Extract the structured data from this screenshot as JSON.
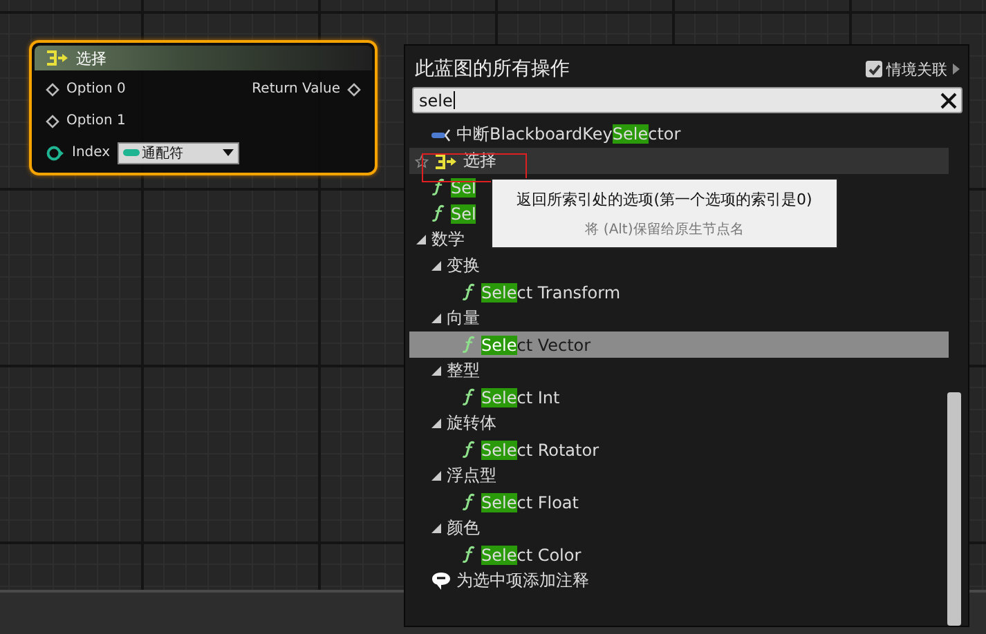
{
  "graph_node": {
    "title": "选择",
    "selected": true,
    "inputs": [
      {
        "label": "Option 0"
      },
      {
        "label": "Option 1"
      }
    ],
    "output": {
      "label": "Return Value"
    },
    "index": {
      "label": "Index",
      "dropdown": "通配符"
    }
  },
  "panel": {
    "title": "此蓝图的所有操作",
    "context_checkbox": {
      "label": "情境关联",
      "checked": true
    },
    "search": {
      "value": "sele"
    },
    "items": [
      {
        "kind": "decorator",
        "selected": false,
        "hovered": false,
        "segments": [
          {
            "text": "中断BlackboardKey",
            "match": false
          },
          {
            "text": "Sele",
            "match": true
          },
          {
            "text": "ctor",
            "match": false
          }
        ]
      },
      {
        "kind": "select",
        "selected": false,
        "hovered": true,
        "segments": [
          {
            "text": "选择",
            "match": false
          }
        ]
      },
      {
        "kind": "function",
        "selected": false,
        "hovered": false,
        "segments": [
          {
            "text": "Sel",
            "match": true
          }
        ]
      },
      {
        "kind": "function",
        "selected": false,
        "hovered": false,
        "segments": [
          {
            "text": "Sel",
            "match": true
          }
        ]
      },
      {
        "kind": "category",
        "label": "数学",
        "expanded": true,
        "children": [
          {
            "kind": "category",
            "label": "变换",
            "expanded": true,
            "children": [
              {
                "kind": "function",
                "selected": false,
                "hovered": false,
                "segments": [
                  {
                    "text": "Sele",
                    "match": true
                  },
                  {
                    "text": "ct Transform",
                    "match": false
                  }
                ]
              }
            ]
          },
          {
            "kind": "category",
            "label": "向量",
            "expanded": true,
            "children": [
              {
                "kind": "function",
                "selected": true,
                "hovered": false,
                "segments": [
                  {
                    "text": "Sele",
                    "match": true
                  },
                  {
                    "text": "ct Vector",
                    "match": false
                  }
                ]
              }
            ]
          },
          {
            "kind": "category",
            "label": "整型",
            "expanded": true,
            "children": [
              {
                "kind": "function",
                "selected": false,
                "hovered": false,
                "segments": [
                  {
                    "text": "Sele",
                    "match": true
                  },
                  {
                    "text": "ct Int",
                    "match": false
                  }
                ]
              }
            ]
          },
          {
            "kind": "category",
            "label": "旋转体",
            "expanded": true,
            "children": [
              {
                "kind": "function",
                "selected": false,
                "hovered": false,
                "segments": [
                  {
                    "text": "Sele",
                    "match": true
                  },
                  {
                    "text": "ct Rotator",
                    "match": false
                  }
                ]
              }
            ]
          },
          {
            "kind": "category",
            "label": "浮点型",
            "expanded": true,
            "children": [
              {
                "kind": "function",
                "selected": false,
                "hovered": false,
                "segments": [
                  {
                    "text": "Sele",
                    "match": true
                  },
                  {
                    "text": "ct Float",
                    "match": false
                  }
                ]
              }
            ]
          },
          {
            "kind": "category",
            "label": "颜色",
            "expanded": true,
            "children": [
              {
                "kind": "function",
                "selected": false,
                "hovered": false,
                "segments": [
                  {
                    "text": "Sele",
                    "match": true
                  },
                  {
                    "text": "ct Color",
                    "match": false
                  }
                ]
              }
            ]
          }
        ]
      },
      {
        "kind": "comment",
        "selected": false,
        "hovered": false,
        "segments": [
          {
            "text": "为选中项添加注释",
            "match": false
          }
        ]
      }
    ],
    "tooltip": {
      "text": "返回所索引处的选项(第一个选项的索引是0)",
      "hint": "将 (Alt)保留给原生节点名"
    }
  }
}
